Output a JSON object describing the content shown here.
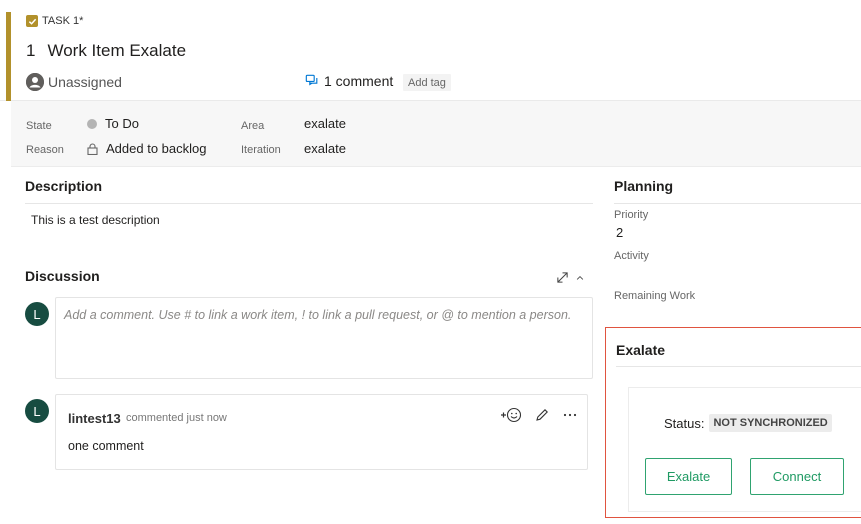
{
  "workitem": {
    "type_label": "TASK 1*",
    "id": "1",
    "title": "Work Item Exalate",
    "assignee": "Unassigned",
    "comments_link": "1 comment",
    "add_tag": "Add tag"
  },
  "fields": {
    "state_label": "State",
    "state_value": "To Do",
    "reason_label": "Reason",
    "reason_value": "Added to backlog",
    "area_label": "Area",
    "area_value": "exalate",
    "iteration_label": "Iteration",
    "iteration_value": "exalate"
  },
  "description": {
    "title": "Description",
    "text": "This is a test description"
  },
  "discussion": {
    "title": "Discussion",
    "user_initial": "L",
    "placeholder": "Add a comment. Use # to link a work item, ! to link a pull request, or @ to mention a person.",
    "comment": {
      "author": "lintest13",
      "meta": "commented just now",
      "body": "one comment",
      "initial": "L"
    }
  },
  "planning": {
    "title": "Planning",
    "priority_label": "Priority",
    "priority_value": "2",
    "activity_label": "Activity",
    "remaining_label": "Remaining Work"
  },
  "exalate": {
    "title": "Exalate",
    "status_label": "Status:",
    "status_value": "NOT SYNCHRONIZED",
    "exalate_button": "Exalate",
    "connect_button": "Connect"
  },
  "colors": {
    "task_accent": "#b2912b",
    "avatar_bg": "#174c41",
    "exalate_border": "#e0533f",
    "button_green": "#1f9a63"
  },
  "icons": {
    "task": "check-square-icon",
    "assignee": "user-avatar-icon",
    "comments": "chat-icon",
    "expand": "expand-diagonal-icon",
    "collapse": "chevron-up-icon",
    "emoji": "add-reaction-icon",
    "edit": "pencil-icon",
    "more": "ellipsis-icon",
    "reason": "lock-icon"
  }
}
